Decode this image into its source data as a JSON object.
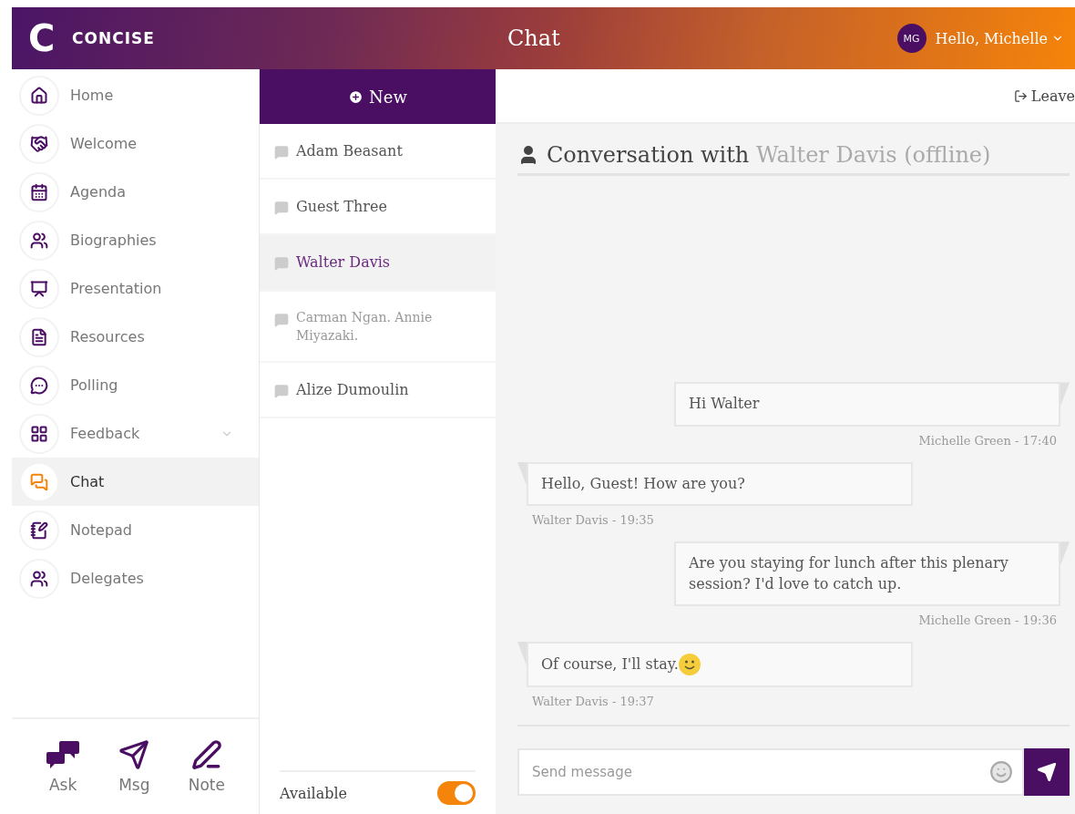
{
  "header": {
    "logo_mark": "C",
    "brand": "CONCISE",
    "title": "Chat",
    "user": {
      "initials": "MG",
      "greeting": "Hello, Michelle"
    }
  },
  "sidebar": {
    "items": [
      {
        "label": "Home",
        "selected": false
      },
      {
        "label": "Welcome",
        "selected": false
      },
      {
        "label": "Agenda",
        "selected": false
      },
      {
        "label": "Biographies",
        "selected": false
      },
      {
        "label": "Presentation",
        "selected": false
      },
      {
        "label": "Resources",
        "selected": false
      },
      {
        "label": "Polling",
        "selected": false
      },
      {
        "label": "Feedback",
        "selected": false,
        "expanded": false
      },
      {
        "label": "Chat",
        "selected": true
      },
      {
        "label": "Notepad",
        "selected": false
      },
      {
        "label": "Delegates",
        "selected": false
      }
    ],
    "shortcuts": [
      {
        "label": "Ask"
      },
      {
        "label": "Msg"
      },
      {
        "label": "Note"
      }
    ]
  },
  "conversations": {
    "new_button": "New",
    "items": [
      {
        "name": "Adam Beasant",
        "selected": false,
        "dimmed": false
      },
      {
        "name": "Guest Three",
        "selected": false,
        "dimmed": false
      },
      {
        "name": "Walter Davis",
        "selected": true,
        "dimmed": false
      },
      {
        "name": "Carman Ngan. Annie Miyazaki.",
        "selected": false,
        "dimmed": true
      },
      {
        "name": "Alize Dumoulin",
        "selected": false,
        "dimmed": false
      }
    ],
    "availability": {
      "label": "Available",
      "on": true
    }
  },
  "chat": {
    "leave": "Leave",
    "heading": "Conversation with",
    "partner": "Walter Davis (offline)",
    "messages": [
      {
        "kind": "sent",
        "text": "Hi Walter",
        "meta": "Michelle Green - 17:40",
        "emoji": false
      },
      {
        "kind": "received",
        "text": "Hello, Guest! How are you?",
        "meta": "Walter Davis - 19:35",
        "emoji": false
      },
      {
        "kind": "sent",
        "text": "Are you staying for lunch after this plenary session? I'd love to catch up.",
        "meta": "Michelle Green - 19:36",
        "emoji": false
      },
      {
        "kind": "received",
        "text": "Of course, I'll stay.",
        "meta": "Walter Davis - 19:37",
        "emoji": true
      }
    ],
    "input": {
      "placeholder": "Send message"
    }
  }
}
